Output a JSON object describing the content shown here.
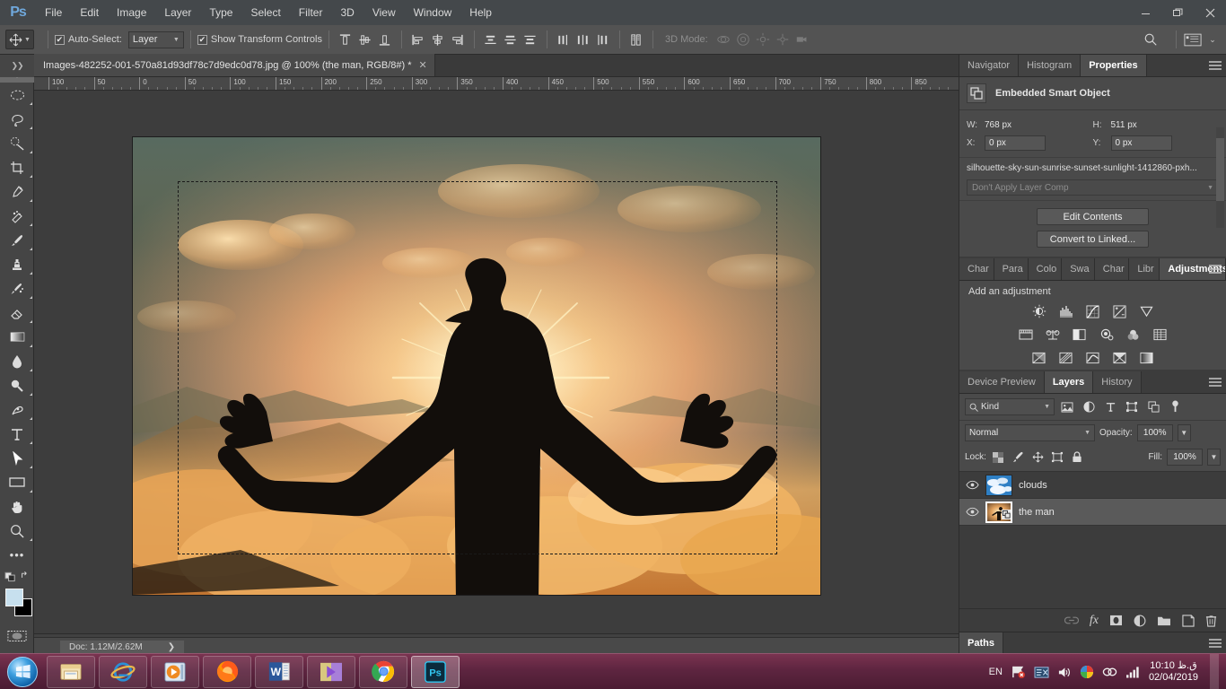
{
  "app": {
    "name": "Adobe Photoshop",
    "logo_text": "Ps"
  },
  "menubar": {
    "items": [
      "File",
      "Edit",
      "Image",
      "Layer",
      "Type",
      "Select",
      "Filter",
      "3D",
      "View",
      "Window",
      "Help"
    ],
    "window_controls": {
      "minimize": "—",
      "restore": "❐",
      "close": "✕"
    }
  },
  "options_bar": {
    "tool_name": "move-tool",
    "auto_select_label": "Auto-Select:",
    "auto_select_checked": "✔",
    "auto_select_value": "Layer",
    "show_transform_label": "Show Transform Controls",
    "show_transform_checked": "✔",
    "three_d_mode_label": "3D Mode:",
    "align_icons": [
      "align-top-edges",
      "align-vertical-centers",
      "align-bottom-edges",
      "align-left-edges",
      "align-horizontal-centers",
      "align-right-edges"
    ],
    "distribute_icons": [
      "distribute-top-edges",
      "distribute-vertical-centers",
      "distribute-bottom-edges",
      "distribute-left-edges",
      "distribute-horizontal-centers",
      "distribute-right-edges"
    ],
    "auto_align_icon": "auto-align-layers",
    "three_d_icons": [
      "3d-orbit",
      "3d-roll",
      "3d-pan",
      "3d-slide",
      "3d-camera"
    ],
    "search_icon": "search-icon",
    "workspace_icon": "workspace-switcher"
  },
  "toolbar": {
    "tools": [
      {
        "name": "move-tool",
        "active": true
      },
      {
        "name": "elliptical-marquee-tool",
        "active": false
      },
      {
        "name": "lasso-tool",
        "active": false
      },
      {
        "name": "quick-selection-tool",
        "active": false
      },
      {
        "name": "crop-tool",
        "active": false
      },
      {
        "name": "eyedropper-tool",
        "active": false
      },
      {
        "name": "spot-healing-brush-tool",
        "active": false
      },
      {
        "name": "brush-tool",
        "active": false
      },
      {
        "name": "clone-stamp-tool",
        "active": false
      },
      {
        "name": "history-brush-tool",
        "active": false
      },
      {
        "name": "eraser-tool",
        "active": false
      },
      {
        "name": "gradient-tool",
        "active": false
      },
      {
        "name": "blur-tool",
        "active": false
      },
      {
        "name": "dodge-tool",
        "active": false
      },
      {
        "name": "pen-tool",
        "active": false
      },
      {
        "name": "horizontal-type-tool",
        "active": false
      },
      {
        "name": "path-selection-tool",
        "active": false
      },
      {
        "name": "rectangle-tool",
        "active": false
      },
      {
        "name": "hand-tool",
        "active": false
      },
      {
        "name": "zoom-tool",
        "active": false
      },
      {
        "name": "edit-toolbar-tool",
        "active": false
      }
    ],
    "foreground_color": "#c7e0ee",
    "background_color": "#000000",
    "quick_mask": "quick-mask-mode"
  },
  "document": {
    "tab_title": "Images-482252-001-570a81d93df78c7d9edc0d78.jpg @ 100% (the man, RGB/8#) *",
    "close_label": "✕",
    "collapse_label": "❯❯",
    "zoom": "100%",
    "color_mode": "RGB/8#"
  },
  "rulers": {
    "horizontal_ticks": [
      "100",
      "50",
      "0",
      "50",
      "100",
      "150",
      "200",
      "250",
      "300",
      "350",
      "400",
      "450",
      "500",
      "550",
      "600",
      "650",
      "700",
      "750",
      "800",
      "850"
    ]
  },
  "status_bar": {
    "doc_label": "Doc: 1.12M/2.62M",
    "arrow": "❯"
  },
  "properties_panel": {
    "tabs": [
      {
        "label": "Navigator",
        "active": false
      },
      {
        "label": "Histogram",
        "active": false
      },
      {
        "label": "Properties",
        "active": true
      }
    ],
    "menu_icon": "panel-menu-icon",
    "header_title": "Embedded Smart Object",
    "header_icon": "smart-object-icon",
    "w_key": "W:",
    "w_value": "768 px",
    "h_key": "H:",
    "h_value": "511 px",
    "x_key": "X:",
    "x_value": "0 px",
    "y_key": "Y:",
    "y_value": "0 px",
    "filename": "silhouette-sky-sun-sunrise-sunset-sunlight-1412860-pxh...",
    "layer_comp": "Don't Apply Layer Comp",
    "edit_contents_label": "Edit Contents",
    "convert_to_linked_label": "Convert to Linked..."
  },
  "adjustments_panel": {
    "tabs": [
      {
        "label": "Char",
        "active": false
      },
      {
        "label": "Para",
        "active": false
      },
      {
        "label": "Colo",
        "active": false
      },
      {
        "label": "Swa",
        "active": false
      },
      {
        "label": "Char",
        "active": false
      },
      {
        "label": "Libr",
        "active": false
      },
      {
        "label": "Adjustments",
        "active": true
      }
    ],
    "menu_icon": "panel-menu-icon",
    "title": "Add an adjustment",
    "row1": [
      "brightness-contrast-icon",
      "levels-icon",
      "curves-icon",
      "exposure-icon",
      "vibrance-icon"
    ],
    "row2": [
      "hue-saturation-icon",
      "color-balance-icon",
      "black-white-icon",
      "photo-filter-icon",
      "channel-mixer-icon",
      "color-lookup-icon"
    ],
    "row3": [
      "invert-icon",
      "posterize-icon",
      "threshold-icon",
      "gradient-map-icon",
      "selective-color-icon"
    ]
  },
  "layers_panel": {
    "tabs": [
      {
        "label": "Device Preview",
        "active": false
      },
      {
        "label": "Layers",
        "active": true
      },
      {
        "label": "History",
        "active": false
      }
    ],
    "menu_icon": "panel-menu-icon",
    "filter_kind": "Kind",
    "filter_icons": [
      "filter-pixel-icon",
      "filter-adjustment-icon",
      "filter-type-icon",
      "filter-shape-icon",
      "filter-smart-object-icon"
    ],
    "filter_toggle": "filter-toggle-switch",
    "blend_mode": "Normal",
    "opacity_label": "Opacity:",
    "opacity_value": "100%",
    "lock_label": "Lock:",
    "lock_icons": [
      "lock-transparent-pixels-icon",
      "lock-image-pixels-icon",
      "lock-position-icon",
      "lock-artboard-nesting-icon",
      "lock-all-icon"
    ],
    "fill_label": "Fill:",
    "fill_value": "100%",
    "layers": [
      {
        "name": "clouds",
        "visible": true,
        "selected": false,
        "thumb": "clouds-thumbnail",
        "smart_object": false
      },
      {
        "name": "the man",
        "visible": true,
        "selected": true,
        "thumb": "the-man-thumbnail",
        "smart_object": true
      }
    ],
    "footer_icons": [
      "link-layers-icon",
      "layer-style-fx-icon",
      "add-layer-mask-icon",
      "new-adjustment-layer-icon",
      "new-group-icon",
      "new-layer-icon",
      "delete-layer-icon"
    ]
  },
  "paths_panel": {
    "tabs": [
      {
        "label": "Paths",
        "active": true
      }
    ],
    "menu_icon": "panel-menu-icon"
  },
  "taskbar": {
    "start_label": "start-orb",
    "items": [
      {
        "name": "file-explorer",
        "active": false
      },
      {
        "name": "internet-explorer",
        "active": false
      },
      {
        "name": "windows-media-player",
        "active": false
      },
      {
        "name": "firefox",
        "active": false
      },
      {
        "name": "microsoft-word",
        "active": false
      },
      {
        "name": "movie-maker",
        "active": false
      },
      {
        "name": "google-chrome",
        "active": false
      },
      {
        "name": "photoshop",
        "active": true
      }
    ],
    "language": "EN",
    "tray_icons": [
      "action-center-icon",
      "network-flag-icon",
      "volume-icon",
      "security-shield-icon",
      "link-icon",
      "signal-bars-icon"
    ],
    "clock_time": "10:10 ق.ظ",
    "clock_date": "02/04/2019"
  }
}
